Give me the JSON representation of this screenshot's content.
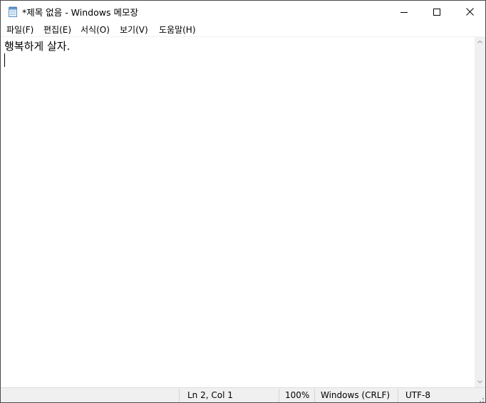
{
  "window": {
    "title": "*제목 없음 - Windows 메모장"
  },
  "menu": {
    "items": [
      {
        "label": "파일(F)"
      },
      {
        "label": "편집(E)"
      },
      {
        "label": "서식(O)"
      },
      {
        "label": "보기(V)"
      },
      {
        "label": "도움말(H)"
      }
    ]
  },
  "editor": {
    "content": "행복하게 살자."
  },
  "status": {
    "position": "Ln 2, Col 1",
    "zoom": "100%",
    "line_ending": "Windows (CRLF)",
    "encoding": "UTF-8"
  },
  "icons": {
    "app": "notepad-icon",
    "minimize": "minimize-icon",
    "maximize": "maximize-icon",
    "close": "close-icon"
  },
  "colors": {
    "border": "#4a4a4a",
    "statusbar_bg": "#f0f0f0",
    "text": "#000000"
  }
}
